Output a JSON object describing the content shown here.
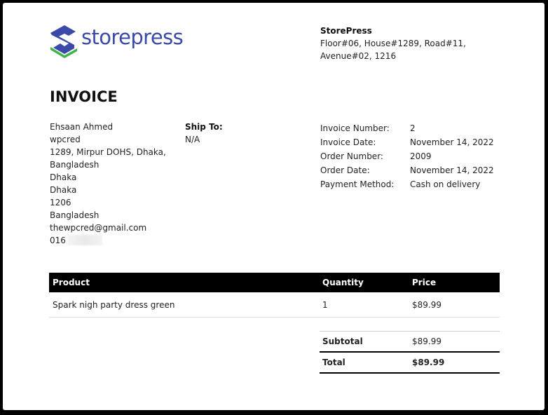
{
  "brand": {
    "logo_text": "storepress",
    "colors": {
      "blue": "#3b4aa8",
      "green": "#3db54a"
    }
  },
  "store": {
    "name": "StorePress",
    "address_line1": "Floor#06, House#1289, Road#11,",
    "address_line2": "Avenue#02, 1216"
  },
  "title": "INVOICE",
  "bill_to": {
    "lines": [
      "Ehsaan Ahmed",
      "wpcred",
      "1289, Mirpur DOHS, Dhaka,",
      "Bangladesh",
      "Dhaka",
      "Dhaka",
      "1206",
      "Bangladesh",
      "thewpcred@gmail.com"
    ],
    "phone_prefix": "016"
  },
  "ship_to": {
    "label": "Ship To:",
    "value": "N/A"
  },
  "meta": [
    {
      "label": "Invoice Number:",
      "value": "2"
    },
    {
      "label": "Invoice Date:",
      "value": "November 14, 2022"
    },
    {
      "label": "Order Number:",
      "value": "2009"
    },
    {
      "label": "Order Date:",
      "value": "November 14, 2022"
    },
    {
      "label": "Payment Method:",
      "value": "Cash on delivery"
    }
  ],
  "table": {
    "headers": {
      "product": "Product",
      "quantity": "Quantity",
      "price": "Price"
    },
    "rows": [
      {
        "product": "Spark nigh party dress green",
        "quantity": "1",
        "price": "$89.99"
      }
    ]
  },
  "totals": {
    "subtotal_label": "Subtotal",
    "subtotal_value": "$89.99",
    "total_label": "Total",
    "total_value": "$89.99"
  }
}
